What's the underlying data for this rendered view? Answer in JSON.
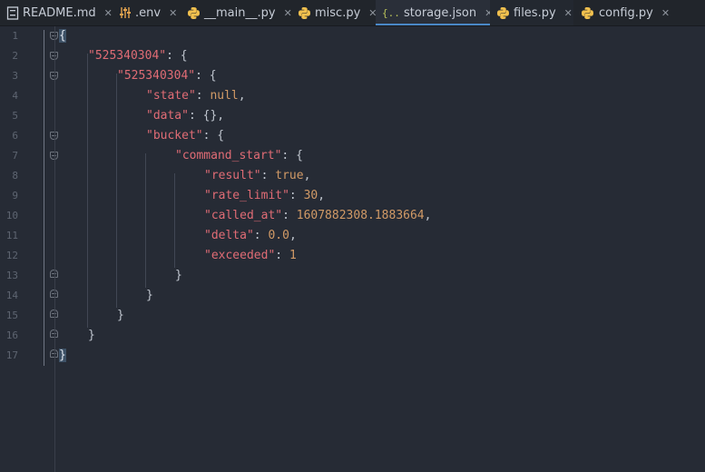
{
  "tabs": [
    {
      "label": "README.md",
      "icon": "markdown-file-icon",
      "active": false
    },
    {
      "label": ".env",
      "icon": "env-settings-icon",
      "active": false
    },
    {
      "label": "__main__.py",
      "icon": "python-file-icon",
      "active": false
    },
    {
      "label": "misc.py",
      "icon": "python-file-icon",
      "active": false
    },
    {
      "label": "storage.json",
      "icon": "json-file-icon",
      "active": true
    },
    {
      "label": "files.py",
      "icon": "python-file-icon",
      "active": false
    },
    {
      "label": "config.py",
      "icon": "python-file-icon",
      "active": false
    }
  ],
  "close_glyph": "✕",
  "line_numbers": [
    "1",
    "2",
    "3",
    "4",
    "5",
    "6",
    "7",
    "8",
    "9",
    "10",
    "11",
    "12",
    "13",
    "14",
    "15",
    "16",
    "17"
  ],
  "code": {
    "l1": {
      "open": "{"
    },
    "l2": {
      "key": "\"525340304\"",
      "sep": ": ",
      "open": "{"
    },
    "l3": {
      "key": "\"525340304\"",
      "sep": ": ",
      "open": "{"
    },
    "l4": {
      "key": "\"state\"",
      "sep": ": ",
      "value": "null",
      "end": ","
    },
    "l5": {
      "key": "\"data\"",
      "sep": ": ",
      "value": "{}",
      "end": ","
    },
    "l6": {
      "key": "\"bucket\"",
      "sep": ": ",
      "open": "{"
    },
    "l7": {
      "key": "\"command_start\"",
      "sep": ": ",
      "open": "{"
    },
    "l8": {
      "key": "\"result\"",
      "sep": ": ",
      "value": "true",
      "end": ","
    },
    "l9": {
      "key": "\"rate_limit\"",
      "sep": ": ",
      "value": "30",
      "end": ","
    },
    "l10": {
      "key": "\"called_at\"",
      "sep": ": ",
      "value": "1607882308.1883664",
      "end": ","
    },
    "l11": {
      "key": "\"delta\"",
      "sep": ": ",
      "value": "0.0",
      "end": ","
    },
    "l12": {
      "key": "\"exceeded\"",
      "sep": ": ",
      "value": "1"
    },
    "l13": {
      "close": "}"
    },
    "l14": {
      "close": "}"
    },
    "l15": {
      "close": "}"
    },
    "l16": {
      "close": "}"
    },
    "l17": {
      "close": "}"
    }
  },
  "colors": {
    "background": "#262b35",
    "key": "#e06c75",
    "number": "#d19a66",
    "active_tab_underline": "#4a88c7"
  }
}
